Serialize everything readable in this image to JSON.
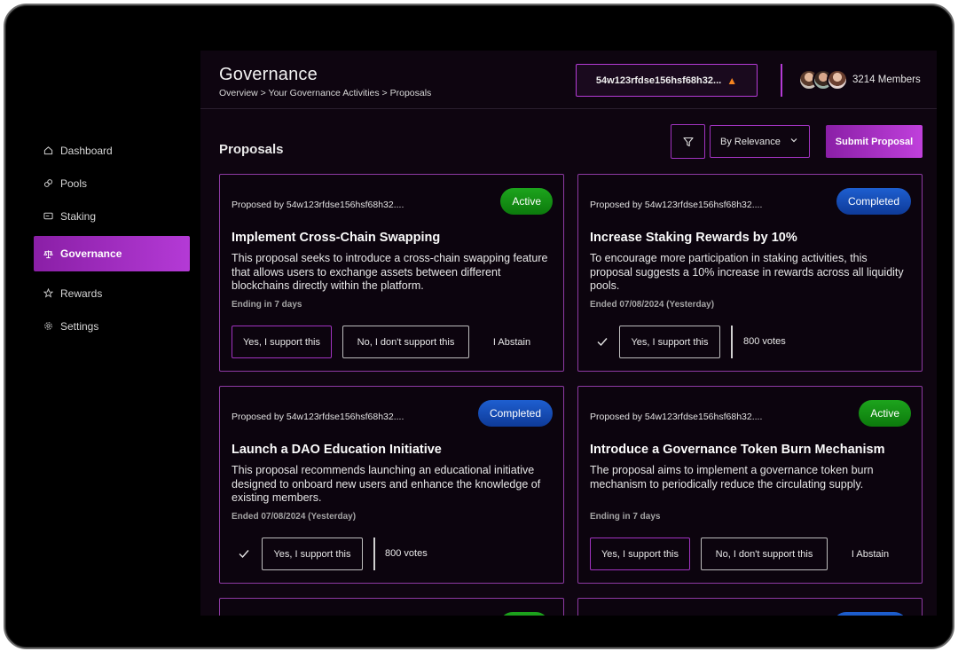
{
  "nav": {
    "items": [
      {
        "label": "Dashboard",
        "icon": "home-icon"
      },
      {
        "label": "Pools",
        "icon": "link-icon"
      },
      {
        "label": "Staking",
        "icon": "card-icon"
      },
      {
        "label": "Governance",
        "icon": "scales-icon",
        "active": true
      },
      {
        "label": "Rewards",
        "icon": "star-icon"
      },
      {
        "label": "Settings",
        "icon": "gear-icon"
      }
    ]
  },
  "header": {
    "title": "Governance",
    "breadcrumb": "Overview > Your Governance Activities > Proposals",
    "wallet": "54w123rfdse156hsf68h32...",
    "members": "3214 Members"
  },
  "toolbar": {
    "section_title": "Proposals",
    "sort_value": "By Relevance",
    "submit_label": "Submit Proposal"
  },
  "cards": [
    {
      "proposer": "Proposed by 54w123rfdse156hsf68h32....",
      "status": "Active",
      "title": "Implement Cross-Chain Swapping",
      "desc": "This proposal seeks to introduce a cross-chain swapping feature that allows users to exchange assets between different blockchains directly within the platform.",
      "timing": "Ending in 7 days",
      "yes": "Yes, I support this",
      "no": "No, I don't support this",
      "abstain": "I Abstain"
    },
    {
      "proposer": "Proposed by 54w123rfdse156hsf68h32....",
      "status": "Completed",
      "title": "Increase Staking Rewards by 10%",
      "desc": "To encourage more participation in staking activities, this proposal suggests a 10% increase in rewards across all liquidity pools.",
      "timing": "Ended 07/08/2024 (Yesterday)",
      "voted": "Yes, I support this",
      "votes": "800 votes"
    },
    {
      "proposer": "Proposed by 54w123rfdse156hsf68h32....",
      "status": "Completed",
      "title": "Launch a DAO Education Initiative",
      "desc": "This proposal recommends launching an educational initiative designed to onboard new users and enhance the knowledge of existing members.",
      "timing": "Ended 07/08/2024 (Yesterday)",
      "voted": "Yes, I support this",
      "votes": "800 votes"
    },
    {
      "proposer": "Proposed by 54w123rfdse156hsf68h32....",
      "status": "Active",
      "title": "Introduce a Governance Token Burn Mechanism",
      "desc": "The proposal aims to implement a governance token burn mechanism to periodically reduce the circulating supply.",
      "timing": "Ending in 7 days",
      "yes": "Yes, I support this",
      "no": "No, I don't support this",
      "abstain": "I Abstain"
    }
  ],
  "colors": {
    "accent": "#b53bd6",
    "active_badge": "#1da41d",
    "completed_badge": "#1e5fd0",
    "panel_bg": "#0e0510"
  }
}
